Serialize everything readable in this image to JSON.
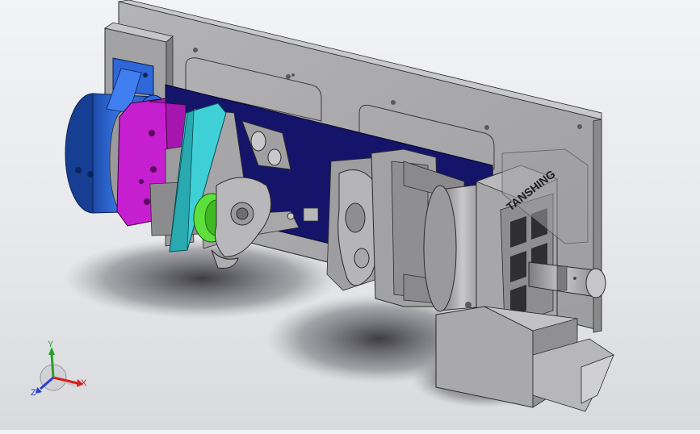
{
  "model": {
    "brand_label": "TANSHING"
  },
  "triad": {
    "x_label": "X",
    "y_label": "Y",
    "z_label": "Z"
  },
  "colors": {
    "background_top": "#f2f3f5",
    "background_bottom": "#d9dadd",
    "plate_gray": "#a9a9ab",
    "navy_plate": "#14146a",
    "blue_motor": "#2f67d6",
    "magenta_flange": "#c51fcf",
    "cyan_plate": "#3ed0d6",
    "green_part": "#5ee03c",
    "axis_x": "#d42020",
    "axis_y": "#2aa02a",
    "axis_z": "#2b3fd0"
  },
  "icons": [
    "view-triad-icon"
  ]
}
